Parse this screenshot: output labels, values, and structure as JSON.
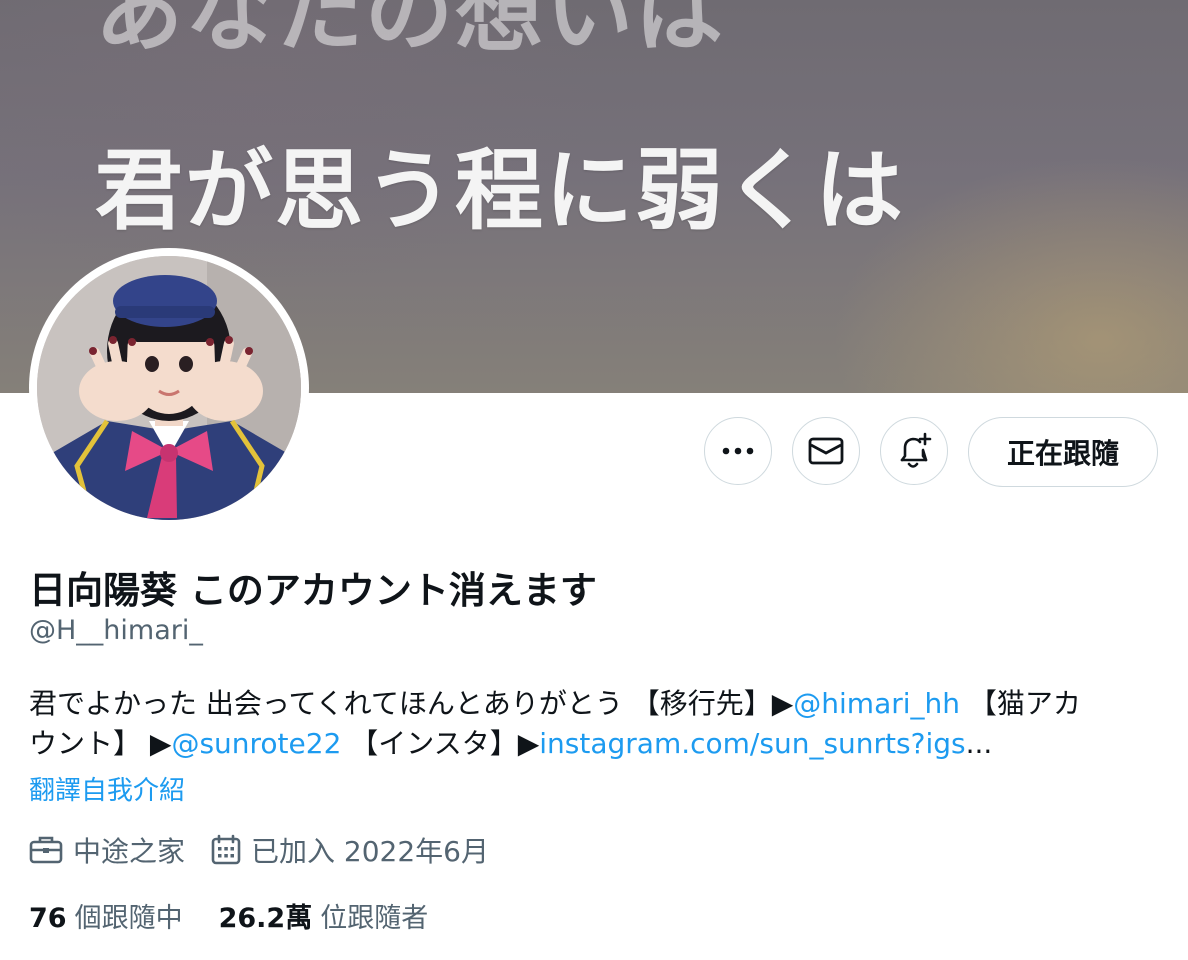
{
  "banner": {
    "ghost_text": "あなたの想いは",
    "headline": "君が思う程に弱くは"
  },
  "actions": {
    "more_icon": "more-horizontal-icon",
    "mail_icon": "mail-icon",
    "notify_icon": "bell-plus-icon",
    "follow_label": "正在跟隨"
  },
  "profile": {
    "display_name": "日向陽葵 このアカウント消えます",
    "handle": "@H__himari_",
    "bio": {
      "line1_text_a": "君でよかった 出会ってくれてほんとありがとう 【移行先】▶",
      "line1_link": "@himari_hh",
      "line1_text_b": " 【猫アカ",
      "line2_text_a": "ウント】 ▶",
      "line2_link_a": "@sunrote22",
      "line2_text_b": " 【インスタ】▶",
      "line2_link_b": "instagram.com/sun_sunrts?igs",
      "line2_ellipsis": "..."
    },
    "translate_label": "翻譯自我介紹",
    "category": "中途之家",
    "joined": "已加入 2022年6月"
  },
  "stats": {
    "following_count": "76",
    "following_label": "個跟隨中",
    "followers_count": "26.2萬",
    "followers_label": "位跟隨者"
  },
  "colors": {
    "link": "#1d9bf0",
    "secondary_text": "#536471",
    "border": "#cfd9de"
  }
}
